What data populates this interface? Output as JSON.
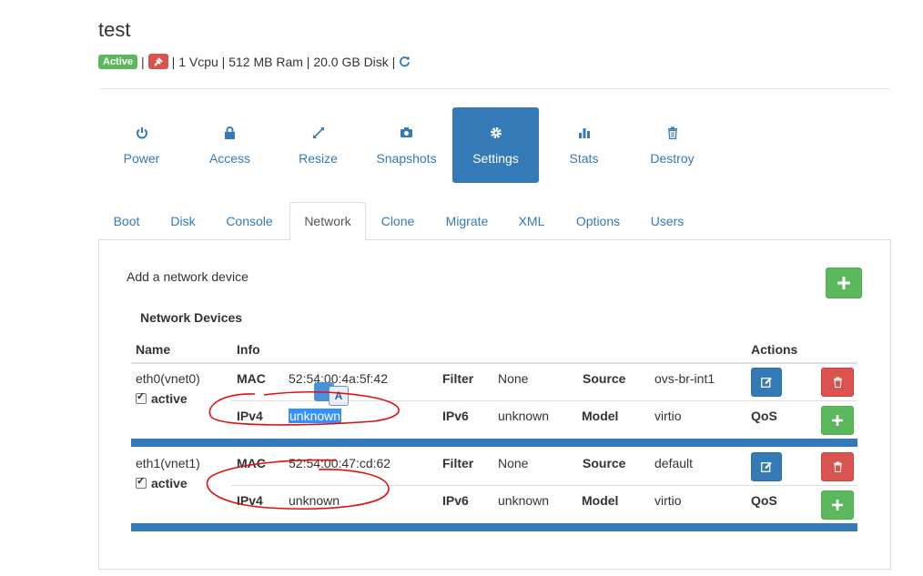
{
  "vm": {
    "name": "test",
    "status": "Active",
    "specs": "| 1 Vcpu | 512 MB Ram | 20.0 GB Disk |"
  },
  "actions": [
    {
      "label": "Power",
      "icon": "power-icon"
    },
    {
      "label": "Access",
      "icon": "lock-icon"
    },
    {
      "label": "Resize",
      "icon": "resize-icon"
    },
    {
      "label": "Snapshots",
      "icon": "camera-icon"
    },
    {
      "label": "Settings",
      "icon": "gear-icon"
    },
    {
      "label": "Stats",
      "icon": "bar-chart-icon"
    },
    {
      "label": "Destroy",
      "icon": "trash-icon"
    }
  ],
  "tabs": [
    "Boot",
    "Disk",
    "Console",
    "Network",
    "Clone",
    "Migrate",
    "XML",
    "Options",
    "Users"
  ],
  "network": {
    "add_label": "Add a network device",
    "section_title": "Network Devices",
    "headers": {
      "name": "Name",
      "info": "Info",
      "actions": "Actions"
    },
    "devices": [
      {
        "name": "eth0(vnet0)",
        "state": "active",
        "mac_label": "MAC",
        "mac": "52:54:00:4a:5f:42",
        "filter_label": "Filter",
        "filter": "None",
        "source_label": "Source",
        "source": "ovs-br-int1",
        "ipv4_label": "IPv4",
        "ipv4": "unknown",
        "ipv6_label": "IPv6",
        "ipv6": "unknown",
        "model_label": "Model",
        "model": "virtio",
        "qos_label": "QoS"
      },
      {
        "name": "eth1(vnet1)",
        "state": "active",
        "mac_label": "MAC",
        "mac": "52:54:00:47:cd:62",
        "filter_label": "Filter",
        "filter": "None",
        "source_label": "Source",
        "source": "default",
        "ipv4_label": "IPv4",
        "ipv4": "unknown",
        "ipv6_label": "IPv6",
        "ipv6": "unknown",
        "model_label": "Model",
        "model": "virtio",
        "qos_label": "QoS"
      }
    ]
  },
  "colors": {
    "primary": "#337ab7",
    "success": "#5cb85c",
    "danger": "#d9534f",
    "annotation": "#e01010"
  }
}
